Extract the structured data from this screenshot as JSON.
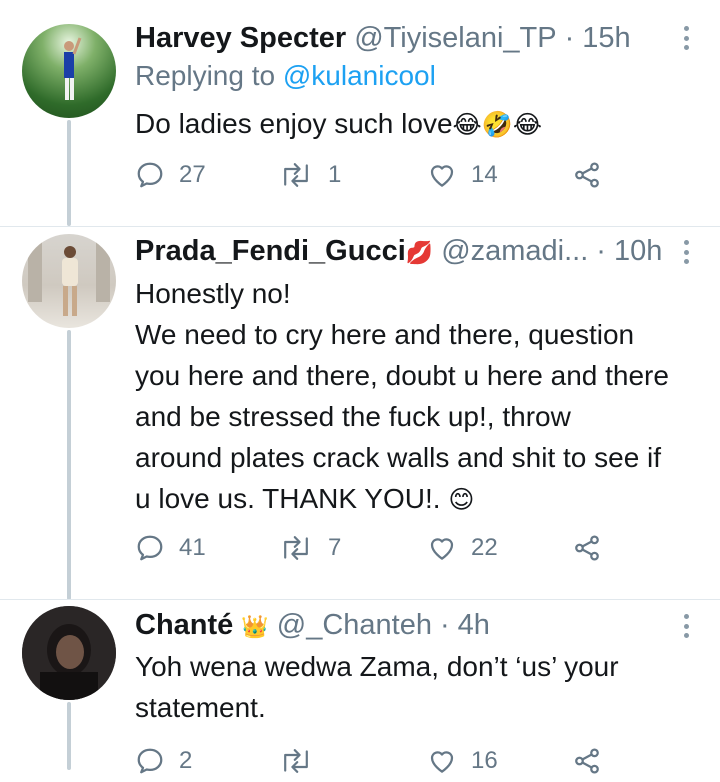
{
  "tweets": [
    {
      "name": "Harvey Specter",
      "handle": "@Tiyiselani_TP",
      "separator": "·",
      "time": "15h",
      "replying_label": "Replying to",
      "replying_handle": "@kulanicool",
      "body_lines": [
        "Do ladies enjoy such love"
      ],
      "body_emoji": "😂🤣😂",
      "replies": "27",
      "retweets": "1",
      "likes": "14"
    },
    {
      "name": "Prada_Fendi_Gucci",
      "name_emoji": "💋",
      "handle": "@zamadi...",
      "separator": "·",
      "time": "10h",
      "body_lines": [
        "Honestly no!",
        "We need to cry here and there, question",
        "you here and there, doubt u here and there",
        "and be stressed the fuck up!, throw",
        "around plates crack walls and shit to see if",
        "u love us. THANK YOU!."
      ],
      "body_emoji": "😊",
      "replies": "41",
      "retweets": "7",
      "likes": "22"
    },
    {
      "name": "Chanté",
      "name_emoji": "👑",
      "handle": "@_Chanteh",
      "separator": "·",
      "time": "4h",
      "body_lines": [
        "Yoh wena wedwa Zama, don’t ‘us’ your",
        "statement."
      ],
      "replies": "2",
      "retweets": "",
      "likes": "16"
    }
  ],
  "colors": {
    "text": "#14171a",
    "secondary": "#657786",
    "link": "#1da1f2",
    "thread_line": "#c4cfd6"
  },
  "icons": [
    "reply-icon",
    "retweet-icon",
    "like-icon",
    "share-icon",
    "more-icon"
  ]
}
